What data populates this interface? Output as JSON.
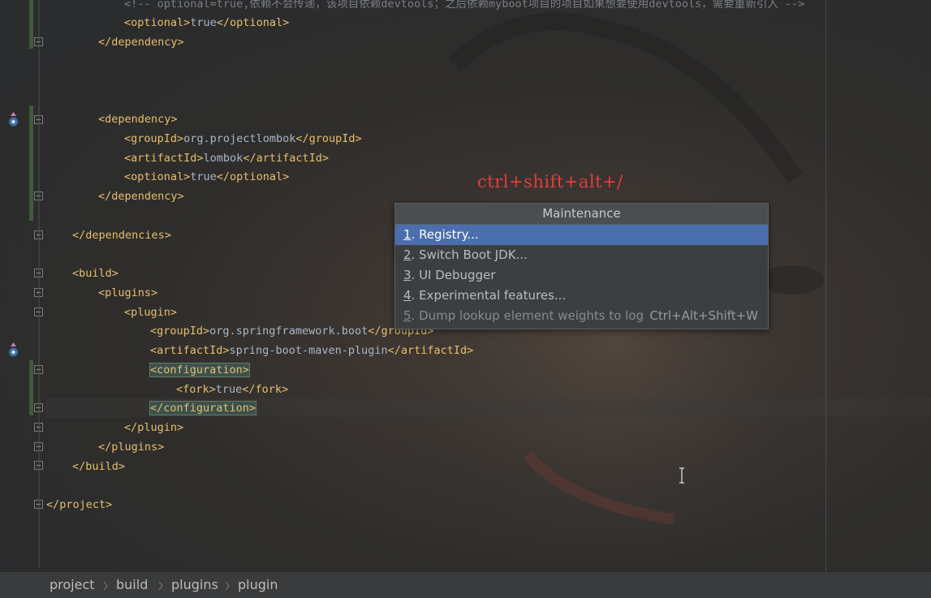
{
  "editor": {
    "lines": [
      {
        "segments": [
          {
            "c": "cm",
            "t": "<!-- optional=true,依赖不会传递，该项目依赖devtools；之后依赖myboot项目的项目如果想要使用devtools，需要重新引入 -->"
          }
        ]
      },
      {
        "segments": [
          {
            "c": "t",
            "t": "<optional>"
          },
          {
            "c": "b",
            "t": "true"
          },
          {
            "c": "t",
            "t": "</optional>"
          }
        ]
      },
      {
        "segments": [
          {
            "c": "t",
            "t": "</dependency>"
          }
        ]
      },
      {
        "segments": [
          {
            "c": "t",
            "t": "<dependency>"
          }
        ]
      },
      {
        "segments": [
          {
            "c": "t",
            "t": "<groupId>"
          },
          {
            "c": "b",
            "t": "org.projectlombok"
          },
          {
            "c": "t",
            "t": "</groupId>"
          }
        ]
      },
      {
        "segments": [
          {
            "c": "t",
            "t": "<artifactId>"
          },
          {
            "c": "b",
            "t": "lombok"
          },
          {
            "c": "t",
            "t": "</artifactId>"
          }
        ]
      },
      {
        "segments": [
          {
            "c": "t",
            "t": "<optional>"
          },
          {
            "c": "b",
            "t": "true"
          },
          {
            "c": "t",
            "t": "</optional>"
          }
        ]
      },
      {
        "segments": [
          {
            "c": "t",
            "t": "</dependency>"
          }
        ]
      },
      {
        "segments": [
          {
            "c": "t",
            "t": "</dependencies>"
          }
        ]
      },
      {
        "segments": [
          {
            "c": "t",
            "t": "<build>"
          }
        ]
      },
      {
        "segments": [
          {
            "c": "t",
            "t": "<plugins>"
          }
        ]
      },
      {
        "segments": [
          {
            "c": "t",
            "t": "<plugin>"
          }
        ]
      },
      {
        "segments": [
          {
            "c": "t",
            "t": "<groupId>"
          },
          {
            "c": "b",
            "t": "org.springframework.boot"
          },
          {
            "c": "t",
            "t": "</groupId>"
          }
        ]
      },
      {
        "segments": [
          {
            "c": "t",
            "t": "<artifactId>"
          },
          {
            "c": "b",
            "t": "spring-boot-maven-plugin"
          },
          {
            "c": "t",
            "t": "</artifactId>"
          }
        ]
      },
      {
        "segments": [
          {
            "c": "t hl",
            "t": "<configuration>"
          }
        ]
      },
      {
        "segments": [
          {
            "c": "t",
            "t": "<fork>"
          },
          {
            "c": "b",
            "t": "true"
          },
          {
            "c": "t",
            "t": "</fork>"
          }
        ]
      },
      {
        "segments": [
          {
            "c": "t hl",
            "t": "</configuration>"
          }
        ]
      },
      {
        "segments": [
          {
            "c": "t",
            "t": "</plugin>"
          }
        ]
      },
      {
        "segments": [
          {
            "c": "t",
            "t": "</plugins>"
          }
        ]
      },
      {
        "segments": [
          {
            "c": "t",
            "t": "</build>"
          }
        ]
      },
      {
        "segments": [
          {
            "c": "t",
            "t": "</project>"
          }
        ]
      }
    ]
  },
  "hint": {
    "text": "ctrl+shift+alt+/"
  },
  "popup": {
    "title": "Maintenance",
    "items": [
      {
        "num": "1",
        "label": ". Registry...",
        "shortcut": "",
        "selected": true,
        "disabled": false
      },
      {
        "num": "2",
        "label": ". Switch Boot JDK...",
        "shortcut": "",
        "selected": false,
        "disabled": false
      },
      {
        "num": "3",
        "label": ". UI Debugger",
        "shortcut": "",
        "selected": false,
        "disabled": false
      },
      {
        "num": "4",
        "label": ". Experimental features...",
        "shortcut": "",
        "selected": false,
        "disabled": false
      },
      {
        "num": "5",
        "label": ". Dump lookup element weights to log",
        "shortcut": "Ctrl+Alt+Shift+W",
        "selected": false,
        "disabled": true
      }
    ]
  },
  "breadcrumb": {
    "items": [
      "project",
      "build",
      "plugins",
      "plugin"
    ]
  },
  "colors": {
    "tag": "#e8bf6a",
    "text": "#a9b7c6",
    "comment": "#7a7e85",
    "hint": "#e63c3c",
    "selection": "#4b6eaf"
  }
}
